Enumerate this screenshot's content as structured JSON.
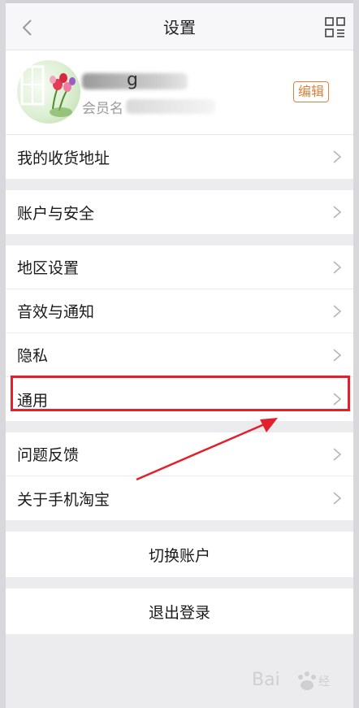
{
  "header": {
    "title": "设置"
  },
  "profile": {
    "member_label": "会员名",
    "edit_label": "编辑"
  },
  "sections": [
    {
      "items": [
        {
          "label": "我的收货地址"
        }
      ]
    },
    {
      "items": [
        {
          "label": "账户与安全"
        }
      ]
    },
    {
      "items": [
        {
          "label": "地区设置"
        },
        {
          "label": "音效与通知"
        },
        {
          "label": "隐私"
        },
        {
          "label": "通用"
        }
      ]
    },
    {
      "items": [
        {
          "label": "问题反馈"
        },
        {
          "label": "关于手机淘宝"
        }
      ]
    }
  ],
  "actions": {
    "switch_account": "切换账户",
    "logout": "退出登录"
  },
  "annotation": {
    "highlight_color": "#e3212d"
  },
  "colors": {
    "accent": "#e1803d",
    "background": "#ececef"
  },
  "icons": {
    "back": "chevron-left-icon",
    "menu": "grid-icon",
    "row": "chevron-right-icon"
  }
}
